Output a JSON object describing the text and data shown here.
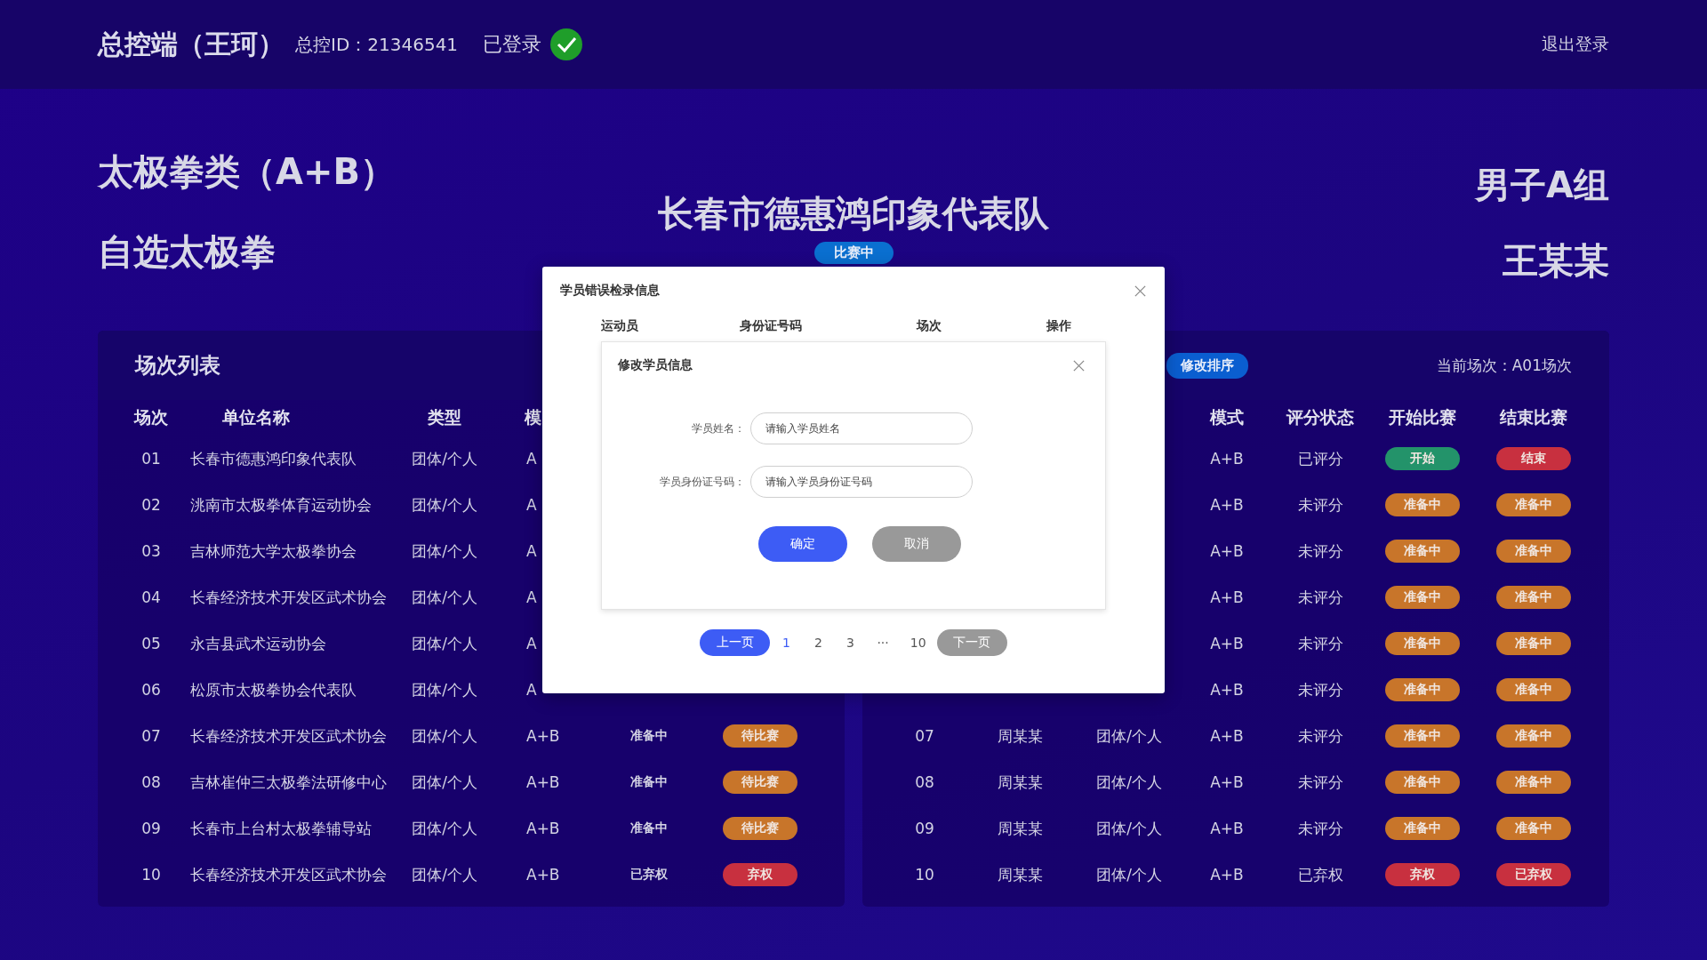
{
  "header": {
    "title": "总控端（王珂）",
    "console_id": "总控ID：21346541",
    "login_status": "已登录",
    "logout": "退出登录"
  },
  "event": {
    "category": "太极拳类（A+B）",
    "routine": "自选太极拳",
    "team": "长春市德惠鸿印象代表队",
    "status_badge": "比赛中",
    "group": "男子A组",
    "athlete": "王某某"
  },
  "left_panel": {
    "title": "场次列表",
    "columns": [
      "场次",
      "单位名称",
      "类型",
      "模"
    ],
    "rows": [
      {
        "no": "01",
        "unit": "长春市德惠鸿印象代表队",
        "type": "团体/个人",
        "mode": "A"
      },
      {
        "no": "02",
        "unit": "洮南市太极拳体育运动协会",
        "type": "团体/个人",
        "mode": "A"
      },
      {
        "no": "03",
        "unit": "吉林师范大学太极拳协会",
        "type": "团体/个人",
        "mode": "A"
      },
      {
        "no": "04",
        "unit": "长春经济技术开发区武术协会",
        "type": "团体/个人",
        "mode": "A"
      },
      {
        "no": "05",
        "unit": "永吉县武术运动协会",
        "type": "团体/个人",
        "mode": "A"
      },
      {
        "no": "06",
        "unit": "松原市太极拳协会代表队",
        "type": "团体/个人",
        "mode": "A"
      },
      {
        "no": "07",
        "unit": "长春经济技术开发区武术协会",
        "type": "团体/个人",
        "mode": "A+B",
        "status": "准备中",
        "action": {
          "label": "待比赛",
          "kind": "waiting"
        }
      },
      {
        "no": "08",
        "unit": "吉林崔仲三太极拳法研修中心",
        "type": "团体/个人",
        "mode": "A+B",
        "status": "准备中",
        "action": {
          "label": "待比赛",
          "kind": "waiting"
        }
      },
      {
        "no": "09",
        "unit": "长春市上台村太极拳辅导站",
        "type": "团体/个人",
        "mode": "A+B",
        "status": "准备中",
        "action": {
          "label": "待比赛",
          "kind": "waiting"
        }
      },
      {
        "no": "10",
        "unit": "长春经济技术开发区武术协会",
        "type": "团体/个人",
        "mode": "A+B",
        "status": "已弃权",
        "action": {
          "label": "弃权",
          "kind": "forfeit"
        }
      }
    ]
  },
  "right_panel": {
    "sort_button": "修改排序",
    "current_round": "当前场次：A01场次",
    "columns": [
      "模式",
      "评分状态",
      "开始比赛",
      "结束比赛"
    ],
    "rows": [
      {
        "mode": "A+B",
        "score_status": "已评分",
        "start": {
          "label": "开始",
          "kind": "start"
        },
        "end": {
          "label": "结束",
          "kind": "end"
        }
      },
      {
        "mode": "A+B",
        "score_status": "未评分",
        "start": {
          "label": "准备中",
          "kind": "ready"
        },
        "end": {
          "label": "准备中",
          "kind": "ready"
        }
      },
      {
        "mode": "A+B",
        "score_status": "未评分",
        "start": {
          "label": "准备中",
          "kind": "ready"
        },
        "end": {
          "label": "准备中",
          "kind": "ready"
        }
      },
      {
        "mode": "A+B",
        "score_status": "未评分",
        "start": {
          "label": "准备中",
          "kind": "ready"
        },
        "end": {
          "label": "准备中",
          "kind": "ready"
        }
      },
      {
        "mode": "A+B",
        "score_status": "未评分",
        "start": {
          "label": "准备中",
          "kind": "ready"
        },
        "end": {
          "label": "准备中",
          "kind": "ready"
        }
      },
      {
        "mode": "A+B",
        "score_status": "未评分",
        "start": {
          "label": "准备中",
          "kind": "ready"
        },
        "end": {
          "label": "准备中",
          "kind": "ready"
        }
      },
      {
        "no": "07",
        "athlete": "周某某",
        "type": "团体/个人",
        "mode": "A+B",
        "score_status": "未评分",
        "start": {
          "label": "准备中",
          "kind": "ready"
        },
        "end": {
          "label": "准备中",
          "kind": "ready"
        }
      },
      {
        "no": "08",
        "athlete": "周某某",
        "type": "团体/个人",
        "mode": "A+B",
        "score_status": "未评分",
        "start": {
          "label": "准备中",
          "kind": "ready"
        },
        "end": {
          "label": "准备中",
          "kind": "ready"
        }
      },
      {
        "no": "09",
        "athlete": "周某某",
        "type": "团体/个人",
        "mode": "A+B",
        "score_status": "未评分",
        "start": {
          "label": "准备中",
          "kind": "ready"
        },
        "end": {
          "label": "准备中",
          "kind": "ready"
        }
      },
      {
        "no": "10",
        "athlete": "周某某",
        "type": "团体/个人",
        "mode": "A+B",
        "score_status": "已弃权",
        "start": {
          "label": "弃权",
          "kind": "forfeit"
        },
        "end": {
          "label": "已弃权",
          "kind": "forfeit"
        }
      }
    ]
  },
  "modal": {
    "title": "学员错误检录信息",
    "columns": [
      "运动员",
      "身份证号码",
      "场次",
      "操作"
    ],
    "dialog": {
      "title": "修改学员信息",
      "fields": [
        {
          "label": "学员姓名：",
          "placeholder": "请输入学员姓名"
        },
        {
          "label": "学员身份证号码：",
          "placeholder": "请输入学员身份证号码"
        }
      ],
      "confirm": "确定",
      "cancel": "取消"
    },
    "pagination": {
      "prev": "上一页",
      "pages": [
        {
          "label": "1",
          "selected": true
        },
        {
          "label": "2",
          "selected": false
        },
        {
          "label": "3",
          "selected": false
        },
        {
          "label": "···",
          "selected": false
        },
        {
          "label": "10",
          "selected": false
        }
      ],
      "next": "下一页"
    }
  }
}
